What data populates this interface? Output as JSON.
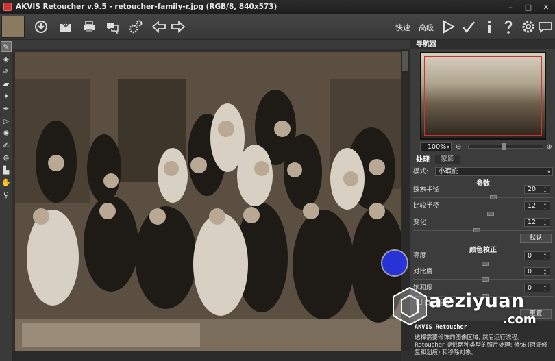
{
  "window": {
    "title": "AKVIS Retoucher v.9.5 - retoucher-family-r.jpg (RGB/8, 840x573)",
    "controls": [
      "–",
      "□",
      "✕"
    ]
  },
  "toolbar": {
    "buttons": [
      "open-icon",
      "save-icon",
      "print-icon",
      "share-icon",
      "settings-gear-icon",
      "back-arrow-icon",
      "forward-arrow-icon"
    ],
    "mode_quick": "快速",
    "mode_advanced": "高级",
    "right_buttons": [
      "run-icon",
      "apply-icon",
      "info-icon",
      "help-icon",
      "preferences-icon",
      "chat-icon"
    ]
  },
  "tools": [
    "brush-icon",
    "eraser-icon",
    "pencil-icon",
    "eraser-block-icon",
    "magic-wand-icon",
    "fill-icon",
    "arrow-icon",
    "stamp-icon",
    "dropper-icon",
    "clone-icon",
    "patch-icon",
    "hand-icon",
    "zoom-icon"
  ],
  "navigator": {
    "title": "导航器",
    "zoom": "100%"
  },
  "tabs": [
    "处理",
    "蒙影"
  ],
  "processing": {
    "mode_label": "模式:",
    "mode_value": "小瑕疵",
    "params_title": "参数",
    "params": [
      {
        "label": "搜索半径",
        "value": "20"
      },
      {
        "label": "比较半径",
        "value": "12"
      },
      {
        "label": "变化",
        "value": "12"
      }
    ],
    "default_button": "默认",
    "color_title": "颜色校正",
    "color": [
      {
        "label": "亮度",
        "value": "0"
      },
      {
        "label": "对比度",
        "value": "0"
      },
      {
        "label": "饱和度",
        "value": "0"
      }
    ],
    "checkbox_label": "自动缩放",
    "reset_button": "重置"
  },
  "info": {
    "title": "AKVIS Retoucher",
    "text1": "选择需要修饰的图像区域, 然后运行流程。",
    "text2": "Retoucher 提供两种类型的照片处理: 修饰 (瑕疵修复和划痕) 和移除对象。"
  },
  "watermark": {
    "text": "aeziyuan",
    "suffix": ".com"
  }
}
